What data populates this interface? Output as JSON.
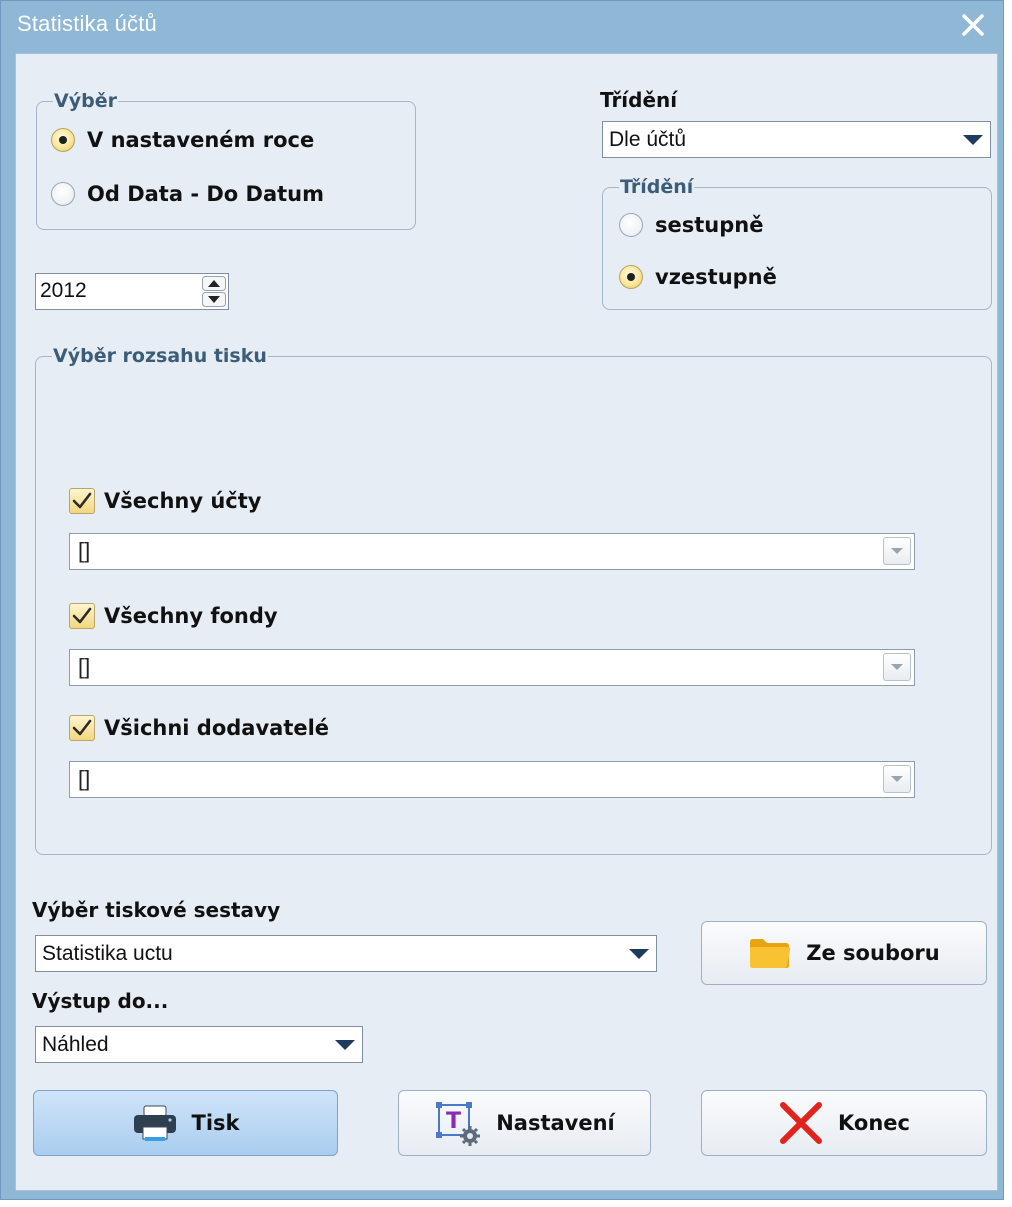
{
  "window": {
    "title": "Statistika účtů"
  },
  "selection_group": {
    "legend": "Výběr",
    "options": [
      "V nastaveném roce",
      "Od Data - Do Datum"
    ],
    "selected_index": 0
  },
  "year_spin": {
    "value": "2012"
  },
  "sorting": {
    "label": "Třídění",
    "combo_value": "Dle účtů",
    "group_legend": "Třídění",
    "options": [
      "sestupně",
      "vzestupně"
    ],
    "selected_index": 1
  },
  "print_range": {
    "legend": "Výběr rozsahu tisku",
    "items": [
      {
        "checkbox_label": "Všechny účty",
        "checked": true,
        "field_value": "[]"
      },
      {
        "checkbox_label": "Všechny fondy",
        "checked": true,
        "field_value": "[]"
      },
      {
        "checkbox_label": "Všichni dodavatelé",
        "checked": true,
        "field_value": "[]"
      }
    ]
  },
  "report": {
    "label": "Výběr tiskové sestavy",
    "combo_value": "Statistika uctu",
    "from_file_button": "Ze souboru"
  },
  "output": {
    "label": "Výstup do...",
    "combo_value": "Náhled"
  },
  "buttons": {
    "print": "Tisk",
    "settings": "Nastavení",
    "close": "Konec"
  },
  "colors": {
    "title_bar": "#8fb7d6",
    "client_bg": "#e7edf4",
    "legend_text": "#3c5d78",
    "primary_button": "#a9cdef",
    "close_icon": "#e0241b",
    "folder_icon": "#f5b21d"
  },
  "icons": {
    "close": "close-icon",
    "folder": "folder-icon",
    "printer": "printer-icon",
    "settings": "text-settings-icon",
    "exit": "red-x-icon"
  }
}
